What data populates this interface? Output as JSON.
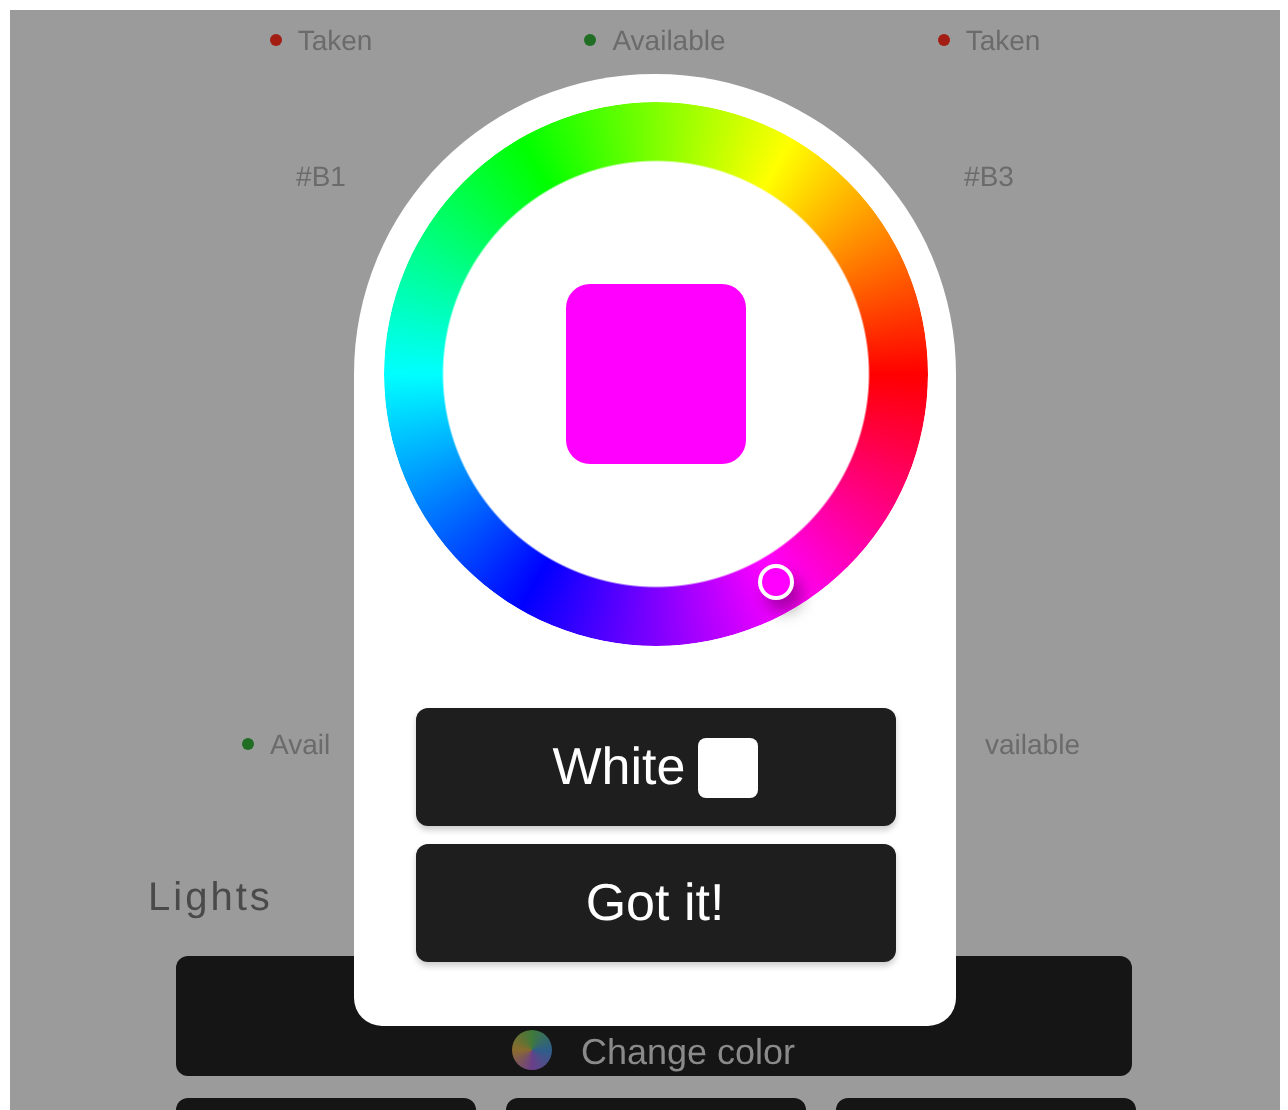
{
  "slots_top": [
    {
      "status": "Taken",
      "color": "#a31d12"
    },
    {
      "status": "Available",
      "color": "#1f6e24"
    },
    {
      "status": "Taken",
      "color": "#a31d12"
    }
  ],
  "slot_labels": [
    "#B1",
    "#B3"
  ],
  "slots_bottom": [
    {
      "status": "Avail",
      "color": "#1f6e24"
    },
    {
      "status": "vailable"
    }
  ],
  "section_title": "Lights",
  "change_color_button": "Change color",
  "picker": {
    "color": "#ff00ff",
    "buttons": [
      {
        "kind": "swatch",
        "label": "White"
      },
      {
        "kind": "plain",
        "label": "Got it!"
      }
    ]
  }
}
